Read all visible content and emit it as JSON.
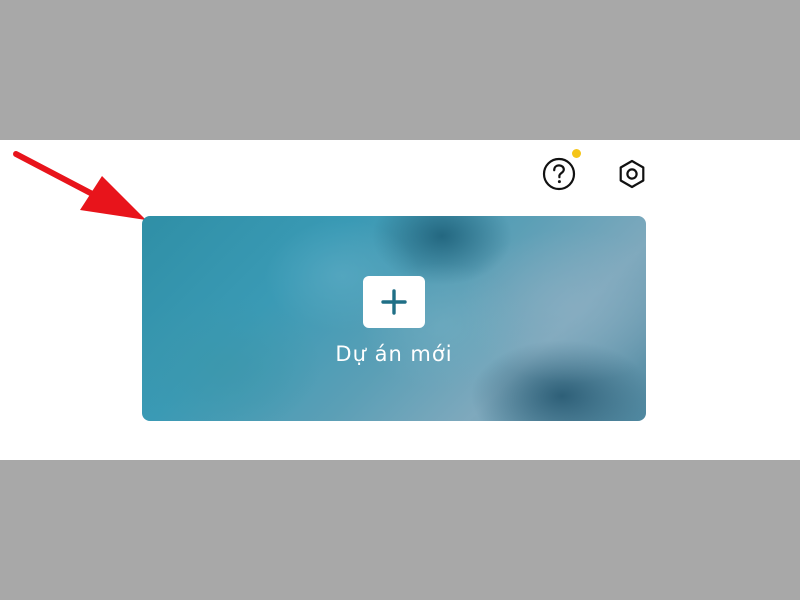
{
  "header": {
    "help_icon": "help-circle-icon",
    "settings_icon": "settings-hexagon-icon",
    "notification_dot_color": "#f5c518"
  },
  "new_project": {
    "label": "Dự án mới",
    "icon": "plus-icon",
    "accent_color": "#2f8fa6"
  },
  "annotation": {
    "arrow_color": "#e8141b"
  }
}
